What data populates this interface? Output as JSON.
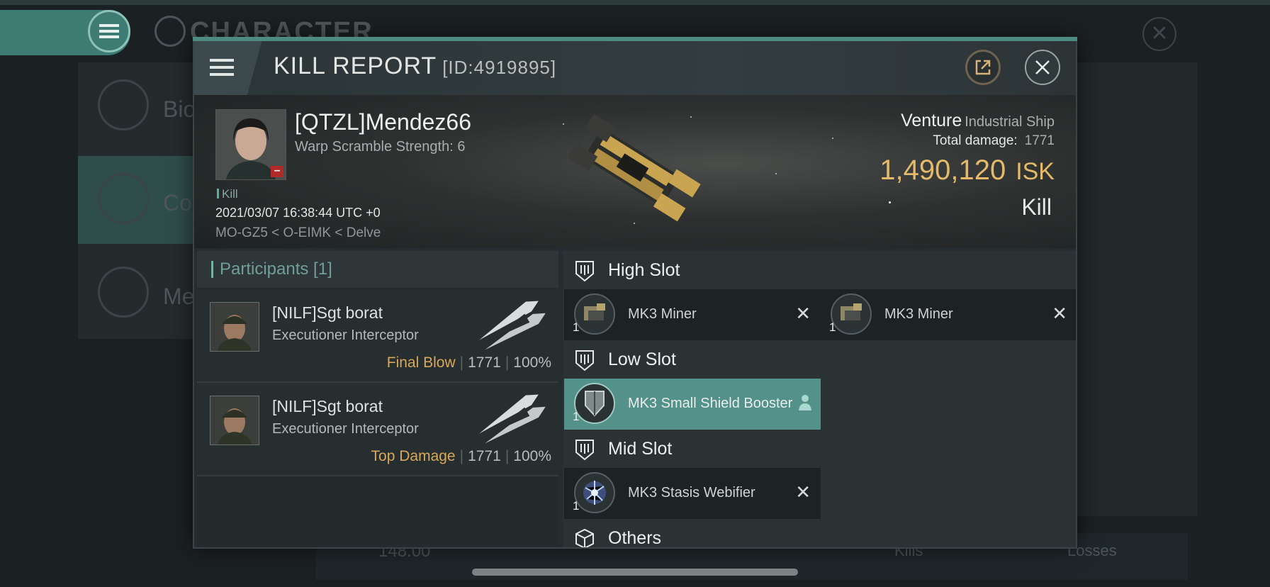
{
  "background": {
    "title": "CHARACTER",
    "sidebar": [
      {
        "label": "Bio"
      },
      {
        "label": "Co"
      },
      {
        "label": "Me"
      }
    ],
    "bottom_value": "148.00",
    "bottom_kills": "Kills",
    "bottom_losses": "Losses"
  },
  "report": {
    "title": "KILL REPORT",
    "id_label": "[ID:4919895]",
    "victim": {
      "name": "[QTZL]Mendez66",
      "subtitle": "Warp Scramble Strength: 6",
      "kill_tag": "Kill",
      "timestamp": "2021/03/07 16:38:44 UTC +0",
      "location": "MO-GZ5 < O-EIMK < Delve"
    },
    "ship": {
      "name": "Venture",
      "class": "Industrial Ship",
      "damage_label": "Total damage:",
      "damage_value": "1771",
      "isk_value": "1,490,120",
      "isk_unit": "ISK",
      "result": "Kill"
    },
    "participants": {
      "header": "Participants [1]",
      "rows": [
        {
          "name": "[NILF]Sgt borat",
          "ship": "Executioner Interceptor",
          "tag": "Final Blow",
          "damage": "1771",
          "percent": "100%"
        },
        {
          "name": "[NILF]Sgt borat",
          "ship": "Executioner Interceptor",
          "tag": "Top Damage",
          "damage": "1771",
          "percent": "100%"
        }
      ]
    },
    "slots": {
      "high": {
        "label": "High Slot",
        "modules": [
          {
            "name": "MK3 Miner",
            "qty": "1"
          },
          {
            "name": "MK3 Miner",
            "qty": "1"
          }
        ]
      },
      "low": {
        "label": "Low Slot",
        "modules": [
          {
            "name": "MK3 Small Shield Booster",
            "qty": "1"
          }
        ]
      },
      "mid": {
        "label": "Mid Slot",
        "modules": [
          {
            "name": "MK3 Stasis Webifier",
            "qty": "1"
          }
        ]
      },
      "others": {
        "label": "Others"
      }
    }
  },
  "colors": {
    "accent": "#4d8a80",
    "isk": "#e3b96a",
    "tag": "#d8a75b",
    "highlight": "#53918a"
  },
  "icons": [
    "menu-icon",
    "external-link-icon",
    "close-icon",
    "slot-shield-icon",
    "box-icon",
    "person-icon",
    "remove-icon"
  ]
}
